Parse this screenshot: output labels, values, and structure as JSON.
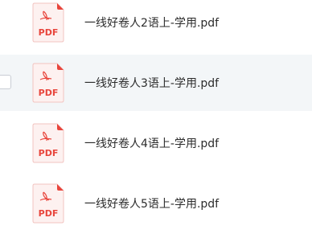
{
  "files": [
    {
      "name": "一线好卷人2语上-学用.pdf",
      "icon": "pdf-file-icon",
      "icon_label": "PDF"
    },
    {
      "name": "一线好卷人3语上-学用.pdf",
      "icon": "pdf-file-icon",
      "icon_label": "PDF"
    },
    {
      "name": "一线好卷人4语上-学用.pdf",
      "icon": "pdf-file-icon",
      "icon_label": "PDF"
    },
    {
      "name": "一线好卷人5语上-学用.pdf",
      "icon": "pdf-file-icon",
      "icon_label": "PDF"
    }
  ],
  "colors": {
    "pdf_red": "#e8453c",
    "pdf_bg": "#fdf1f0",
    "hover_row": "#f3f6f8",
    "text": "#2c2c2c"
  }
}
